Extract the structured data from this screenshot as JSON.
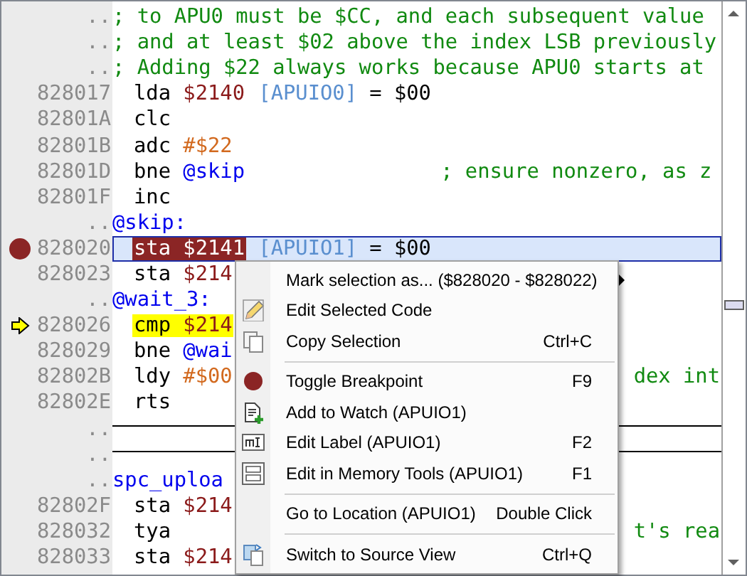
{
  "code_view": {
    "rows": [
      {
        "address": "..",
        "kind": "comment",
        "selected": false,
        "text": "; to APU0 must be $CC, and each subsequent value"
      },
      {
        "address": "..",
        "kind": "comment",
        "selected": false,
        "text": "; and at least $02 above the index LSB previously"
      },
      {
        "address": "..",
        "kind": "comment",
        "selected": false,
        "text": "; Adding $22 always works because APU0 starts at"
      },
      {
        "address": "828017",
        "kind": "code",
        "selected": false,
        "parts": [
          {
            "kind": "op",
            "text": "lda"
          },
          {
            "kind": "addr",
            "text": "$2140"
          },
          {
            "kind": "alias",
            "text": "[APUIO0]"
          },
          {
            "kind": "text",
            "text": "= $00"
          }
        ]
      },
      {
        "address": "82801A",
        "kind": "code",
        "selected": false,
        "parts": [
          {
            "kind": "op",
            "text": "clc"
          }
        ]
      },
      {
        "address": "82801B",
        "kind": "code",
        "selected": false,
        "parts": [
          {
            "kind": "op",
            "text": "adc"
          },
          {
            "kind": "imm",
            "text": "#$22"
          }
        ]
      },
      {
        "address": "82801D",
        "kind": "code",
        "selected": false,
        "parts": [
          {
            "kind": "op",
            "text": "bne"
          },
          {
            "kind": "label_ref",
            "text": "@skip"
          },
          {
            "kind": "comment",
            "text": "; ensure nonzero, as z"
          }
        ]
      },
      {
        "address": "82801F",
        "kind": "code",
        "selected": false,
        "parts": [
          {
            "kind": "op",
            "text": "inc"
          }
        ]
      },
      {
        "address": "..",
        "kind": "label",
        "selected": false,
        "text": "@skip:"
      },
      {
        "address": "828020",
        "kind": "code",
        "selected": true,
        "breakpoint": true,
        "parts": [
          {
            "kind": "op",
            "text": "sta"
          },
          {
            "kind": "addr",
            "text": "$2141"
          },
          {
            "kind": "alias",
            "text": "[APUIO1]"
          },
          {
            "kind": "text",
            "text": "= $00"
          }
        ]
      },
      {
        "address": "828023",
        "kind": "code",
        "selected": false,
        "parts": [
          {
            "kind": "op",
            "text": "sta"
          },
          {
            "kind": "addr",
            "text": "$214"
          }
        ]
      },
      {
        "address": "..",
        "kind": "label",
        "selected": false,
        "text": "@wait_3:"
      },
      {
        "address": "828026",
        "kind": "code",
        "selected": false,
        "current": true,
        "parts": [
          {
            "kind": "op",
            "text": "cmp"
          },
          {
            "kind": "addr",
            "text": "$214"
          }
        ]
      },
      {
        "address": "828029",
        "kind": "code",
        "selected": false,
        "parts": [
          {
            "kind": "op",
            "text": "bne"
          },
          {
            "kind": "label_ref",
            "text": "@wai"
          }
        ]
      },
      {
        "address": "82802B",
        "kind": "code",
        "selected": false,
        "parts": [
          {
            "kind": "op",
            "text": "ldy"
          },
          {
            "kind": "imm",
            "text": "#$00"
          },
          {
            "kind": "tail",
            "text": "dex int"
          }
        ]
      },
      {
        "address": "82802E",
        "kind": "code",
        "selected": false,
        "parts": [
          {
            "kind": "op",
            "text": "rts"
          }
        ]
      },
      {
        "address": "..",
        "kind": "separator",
        "selected": false
      },
      {
        "address": "..",
        "kind": "separator",
        "selected": false
      },
      {
        "address": "..",
        "kind": "label",
        "selected": false,
        "text": "spc_uploa"
      },
      {
        "address": "82802F",
        "kind": "code",
        "selected": false,
        "parts": [
          {
            "kind": "op",
            "text": "sta"
          },
          {
            "kind": "addr",
            "text": "$214"
          }
        ]
      },
      {
        "address": "828032",
        "kind": "code",
        "selected": false,
        "parts": [
          {
            "kind": "op",
            "text": "tya"
          },
          {
            "kind": "tail",
            "text": "t's rea"
          }
        ]
      },
      {
        "address": "828033",
        "kind": "code",
        "selected": false,
        "parts": [
          {
            "kind": "op",
            "text": "sta"
          },
          {
            "kind": "addr",
            "text": "$214"
          }
        ]
      }
    ]
  },
  "context_menu": {
    "items": [
      {
        "kind": "item",
        "label": "Mark selection as... ($828020 - $828022)",
        "has_submenu": true
      },
      {
        "kind": "item",
        "label": "Edit Selected Code"
      },
      {
        "kind": "item",
        "label": "Copy Selection",
        "shortcut": "Ctrl+C"
      },
      {
        "kind": "separator"
      },
      {
        "kind": "item",
        "label": "Toggle Breakpoint",
        "shortcut": "F9"
      },
      {
        "kind": "item",
        "label": "Add to Watch (APUIO1)"
      },
      {
        "kind": "item",
        "label": "Edit Label (APUIO1)",
        "shortcut": "F2"
      },
      {
        "kind": "item",
        "label": "Edit in Memory Tools (APUIO1)",
        "shortcut": "F1"
      },
      {
        "kind": "separator"
      },
      {
        "kind": "item",
        "label": "Go to Location (APUIO1)",
        "shortcut": "Double Click"
      },
      {
        "kind": "separator"
      },
      {
        "kind": "item",
        "label": "Switch to Source View",
        "shortcut": "Ctrl+Q"
      }
    ]
  }
}
